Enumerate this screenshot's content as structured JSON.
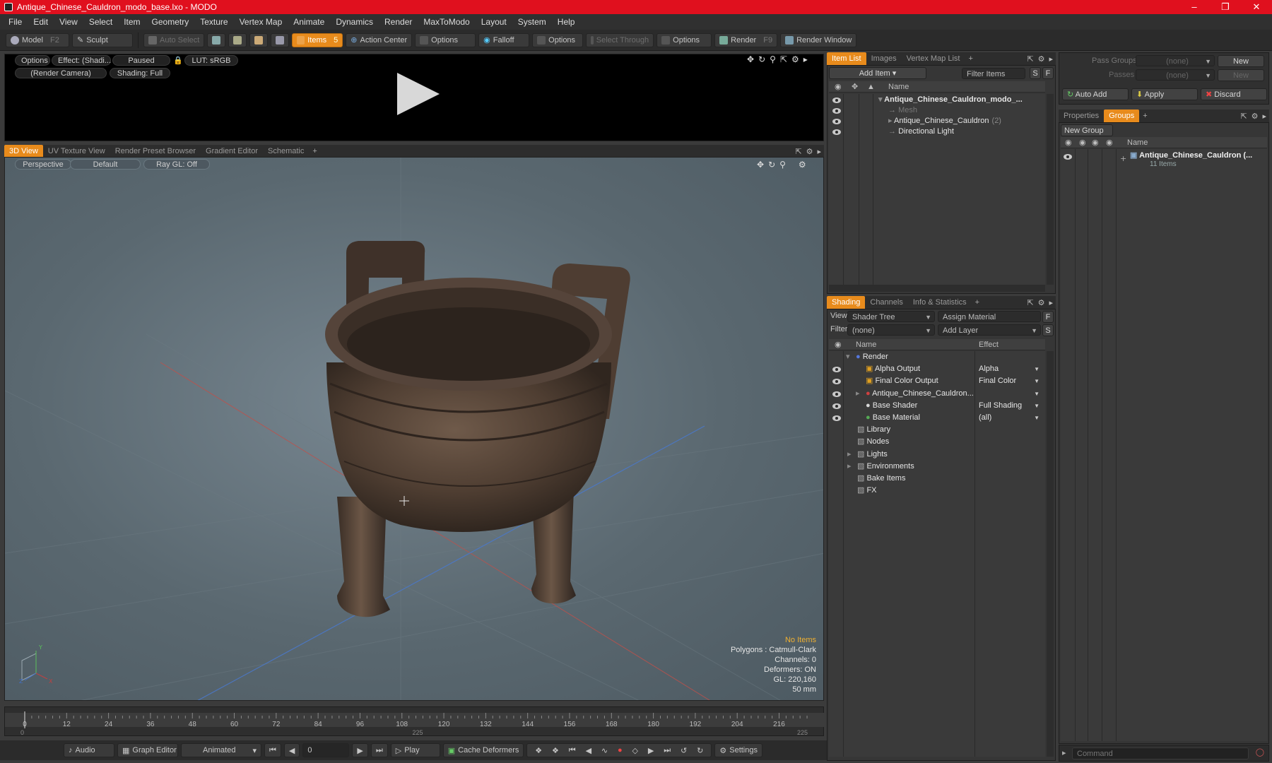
{
  "window": {
    "title": "Antique_Chinese_Cauldron_modo_base.lxo - MODO"
  },
  "menu": [
    "File",
    "Edit",
    "View",
    "Select",
    "Item",
    "Geometry",
    "Texture",
    "Vertex Map",
    "Animate",
    "Dynamics",
    "Render",
    "MaxToModo",
    "Layout",
    "System",
    "Help"
  ],
  "toolbar": {
    "model": "Model",
    "model_key": "F2",
    "sculpt": "Sculpt",
    "auto_select": "Auto Select",
    "items": "Items",
    "items_key": "5",
    "action_center": "Action Center",
    "options1": "Options",
    "falloff": "Falloff",
    "options2": "Options",
    "select_through": "Select Through",
    "options3": "Options",
    "render": "Render",
    "render_key": "F9",
    "render_window": "Render Window"
  },
  "preview": {
    "options": "Options",
    "effect": "Effect: (Shadi...",
    "paused": "Paused",
    "lut": "LUT: sRGB",
    "camera": "(Render Camera)",
    "shading": "Shading: Full"
  },
  "viewtabs": [
    "3D View",
    "UV Texture View",
    "Render Preset Browser",
    "Gradient Editor",
    "Schematic"
  ],
  "viewport": {
    "projection": "Perspective",
    "style": "Default",
    "raygl": "Ray GL: Off",
    "info": {
      "noitems": "No Items",
      "polygons": "Polygons : Catmull-Clark",
      "channels": "Channels: 0",
      "deformers": "Deformers: ON",
      "gl": "GL: 220,160",
      "scale": "50 mm"
    },
    "axis_x": "X",
    "axis_y": "Y",
    "axis_z": "Z"
  },
  "timeline": {
    "ticks": [
      "0",
      "12",
      "24",
      "36",
      "48",
      "60",
      "72",
      "84",
      "96",
      "108",
      "120",
      "132",
      "144",
      "156",
      "168",
      "180",
      "192",
      "204",
      "216"
    ],
    "start": "0",
    "mid": "225",
    "end": "225"
  },
  "bottombar": {
    "audio": "Audio",
    "graph_editor": "Graph Editor",
    "animated": "Animated",
    "frame": "0",
    "play": "Play",
    "cache_deformers": "Cache Deformers",
    "settings": "Settings"
  },
  "itemlist": {
    "tabs": [
      "Item List",
      "Images",
      "Vertex Map List"
    ],
    "add_item": "Add Item",
    "filter_items": "Filter Items",
    "s": "S",
    "f": "F",
    "col_name": "Name",
    "rows": [
      {
        "label": "Antique_Chinese_Cauldron_modo_...",
        "bold": true,
        "indent": 0
      },
      {
        "label": "Mesh",
        "dim": true,
        "indent": 1
      },
      {
        "label": "Antique_Chinese_Cauldron",
        "suffix": "(2)",
        "indent": 1
      },
      {
        "label": "Directional Light",
        "indent": 1
      }
    ]
  },
  "shading": {
    "tabs": [
      "Shading",
      "Channels",
      "Info & Statistics"
    ],
    "view_label": "View",
    "view_value": "Shader Tree",
    "assign_material": "Assign Material",
    "filter_label": "Filter",
    "filter_value": "(none)",
    "add_layer": "Add Layer",
    "f": "F",
    "s": "S",
    "col_name": "Name",
    "col_effect": "Effect",
    "rows": [
      {
        "label": "Render",
        "effect": "",
        "indent": 0
      },
      {
        "label": "Alpha Output",
        "effect": "Alpha",
        "indent": 1
      },
      {
        "label": "Final Color Output",
        "effect": "Final Color",
        "indent": 1
      },
      {
        "label": "Antique_Chinese_Cauldron...",
        "effect": "",
        "indent": 1
      },
      {
        "label": "Base Shader",
        "effect": "Full Shading",
        "indent": 1
      },
      {
        "label": "Base Material",
        "effect": "(all)",
        "indent": 1
      },
      {
        "label": "Library",
        "effect": "",
        "indent": 0
      },
      {
        "label": "Nodes",
        "effect": "",
        "indent": 0
      },
      {
        "label": "Lights",
        "effect": "",
        "indent": 0
      },
      {
        "label": "Environments",
        "effect": "",
        "indent": 0
      },
      {
        "label": "Bake Items",
        "effect": "",
        "indent": 0
      },
      {
        "label": "FX",
        "effect": "",
        "indent": 0
      }
    ]
  },
  "groups": {
    "pass_groups": "Pass Groups",
    "pass_groups_value": "(none)",
    "new1": "New",
    "passes": "Passes",
    "passes_value": "(none)",
    "new2": "New",
    "auto_add": "Auto Add",
    "apply": "Apply",
    "discard": "Discard",
    "tabs": [
      "Properties",
      "Groups"
    ],
    "new_group": "New Group",
    "col_name": "Name",
    "group_name": "Antique_Chinese_Cauldron (...",
    "group_count": "11 Items"
  },
  "command": {
    "placeholder": "Command"
  }
}
